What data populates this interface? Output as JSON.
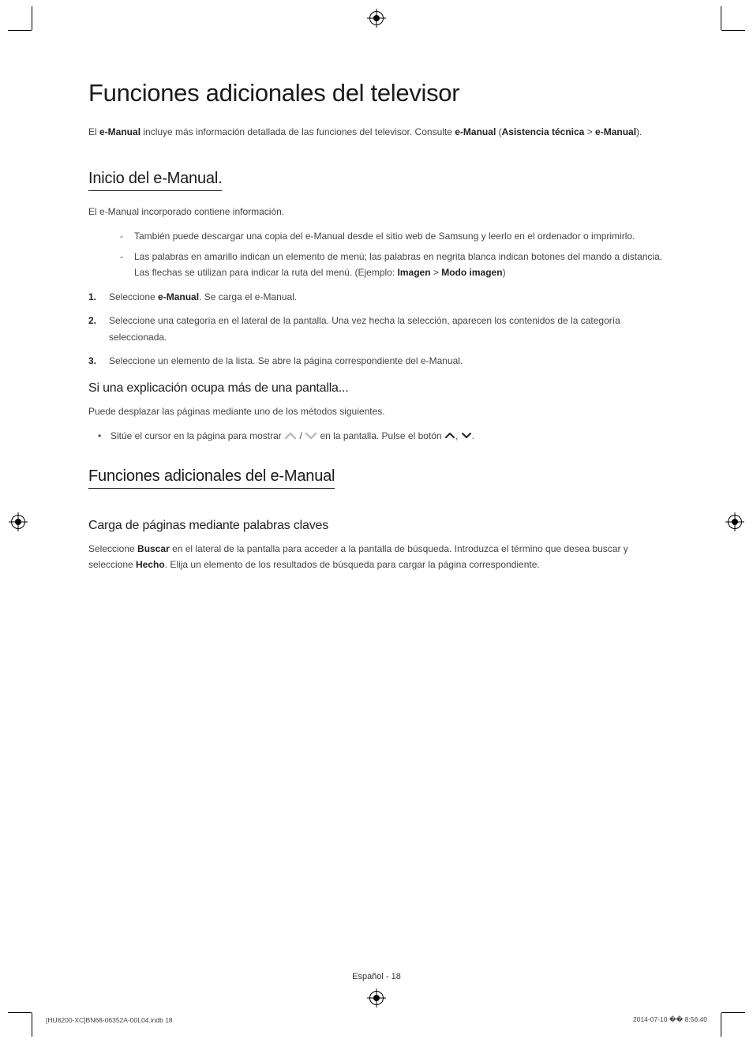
{
  "title": "Funciones adicionales del televisor",
  "intro": {
    "pre": "El ",
    "b1": "e-Manual",
    "mid": " incluye más información detallada de las funciones del televisor. Consulte ",
    "b2": "e-Manual",
    "paren_open": " (",
    "b3": "Asistencia técnica",
    "gt": " > ",
    "b4": "e-Manual",
    "paren_close": ")."
  },
  "s1": {
    "heading": "Inicio del e-Manual.",
    "lead": "El e-Manual incorporado contiene información.",
    "dash1": "También puede descargar una copia del e-Manual desde el sitio web de Samsung y leerlo en el ordenador o imprimirlo.",
    "dash2_pre": "Las palabras en amarillo indican un elemento de menú; las palabras en negrita blanca indican botones del mando a distancia. Las flechas se utilizan para indicar la ruta del menú. (Ejemplo: ",
    "dash2_b1": "Imagen",
    "dash2_gt": " > ",
    "dash2_b2": "Modo imagen",
    "dash2_post": ")",
    "n1_num": "1.",
    "n1_pre": "Seleccione ",
    "n1_b": "e-Manual",
    "n1_post": ". Se carga el e-Manual.",
    "n2_num": "2.",
    "n2": "Seleccione una categoría en el lateral de la pantalla. Una vez hecha la selección, aparecen los contenidos de la categoría seleccionada.",
    "n3_num": "3.",
    "n3": "Seleccione un elemento de la lista. Se abre la página correspondiente del e-Manual.",
    "subhead": "Si una explicación ocupa más de una pantalla...",
    "sublead": "Puede desplazar las páginas mediante uno de los métodos siguientes.",
    "bullet_pre": "Sitúe el cursor en la página para mostrar ",
    "bullet_mid": " en la pantalla. Pulse el botón ",
    "bullet_sep": ", ",
    "bullet_end": "."
  },
  "s2": {
    "heading": "Funciones adicionales del e-Manual",
    "subhead": "Carga de páginas mediante palabras claves",
    "p_pre": "Seleccione ",
    "p_b1": "Buscar",
    "p_mid": " en el lateral de la pantalla para acceder a la pantalla de búsqueda. Introduzca el término que desea buscar y seleccione ",
    "p_b2": "Hecho",
    "p_post": ". Elija un elemento de los resultados de búsqueda para cargar la página correspondiente."
  },
  "footer": {
    "center": "Español - 18",
    "left": "[HU8200-XC]BN68-06352A-00L04.indb   18",
    "right": "2014-07-10   �� 8:56:40"
  }
}
